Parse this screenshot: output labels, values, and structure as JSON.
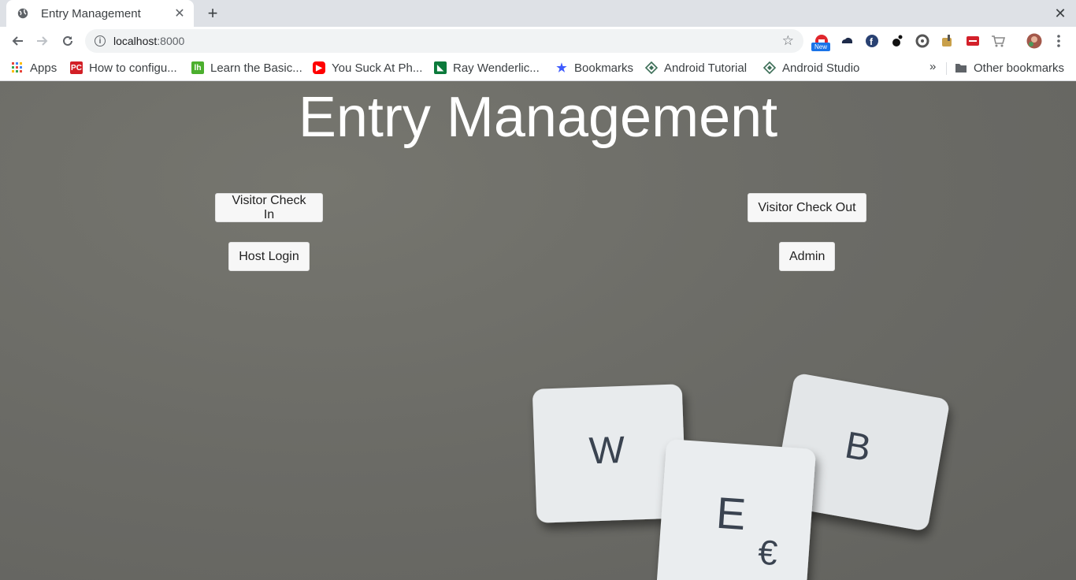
{
  "browser": {
    "tab": {
      "title": "Entry Management"
    },
    "url": {
      "host": "localhost",
      "port": ":8000"
    },
    "new_badge": "New",
    "bookmarks": [
      {
        "label": "Apps",
        "icon": "apps-grid-icon"
      },
      {
        "label": "How to configu...",
        "icon": "pc-icon"
      },
      {
        "label": "Learn the Basic...",
        "icon": "lh-icon"
      },
      {
        "label": "You Suck At Ph...",
        "icon": "youtube-icon"
      },
      {
        "label": "Ray Wenderlic...",
        "icon": "rw-icon"
      },
      {
        "label": "Bookmarks",
        "icon": "star-icon"
      },
      {
        "label": "Android Tutorial",
        "icon": "diamond-icon"
      },
      {
        "label": "Android Studio",
        "icon": "diamond-icon"
      }
    ],
    "other_bookmarks": "Other bookmarks",
    "overflow": "»"
  },
  "page": {
    "title": "Entry Management",
    "buttons": {
      "visitor_check_in": "Visitor Check In",
      "visitor_check_out": "Visitor Check Out",
      "host_login": "Host Login",
      "admin": "Admin"
    },
    "tiles": [
      "W",
      "E",
      "B"
    ],
    "tile_extra": "€"
  },
  "colors": {
    "background": "#6d6d69",
    "tile": "#e8ebed",
    "title_text": "#ffffff"
  }
}
